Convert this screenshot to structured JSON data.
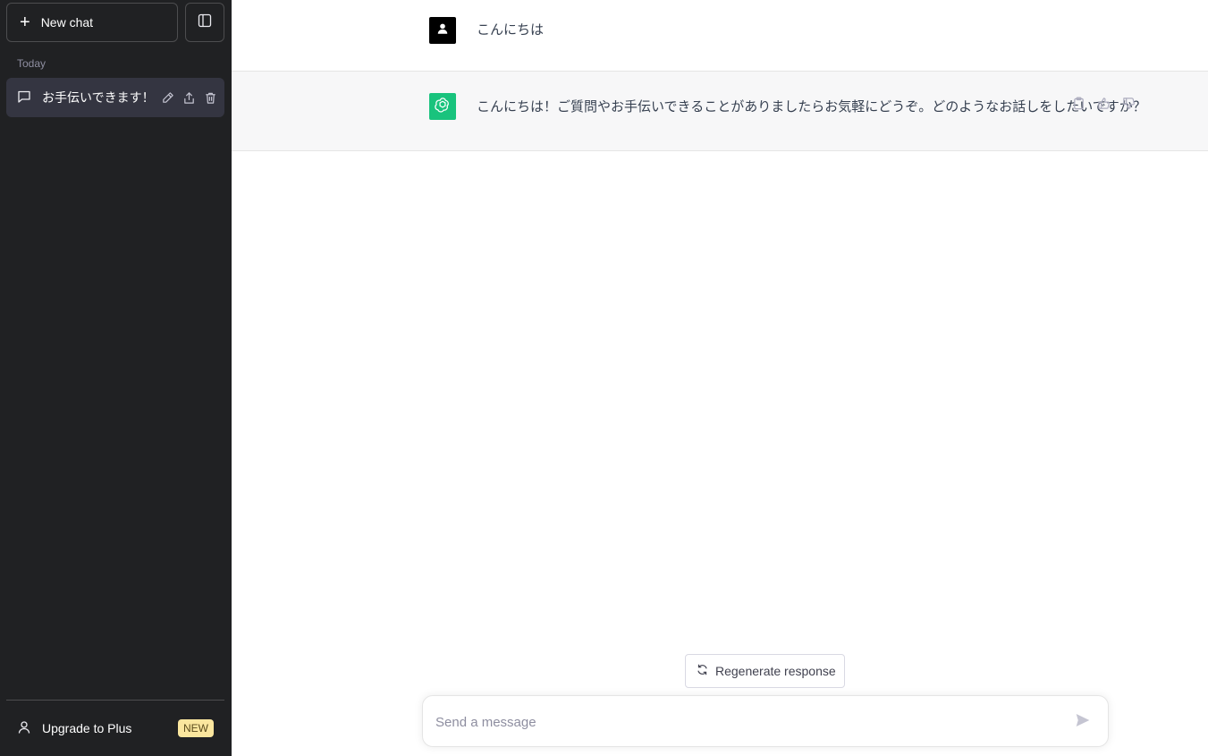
{
  "sidebar": {
    "new_chat_label": "New chat",
    "section_label": "Today",
    "items": [
      {
        "label": "お手伝いできます！"
      }
    ],
    "upgrade_label": "Upgrade to Plus",
    "upgrade_badge": "NEW"
  },
  "conversation": {
    "user_message": "こんにちは",
    "assistant_message": "こんにちは！ご質問やお手伝いできることがありましたらお気軽にどうぞ。どのようなお話しをしたいですか？"
  },
  "regenerate_label": "Regenerate response",
  "composer": {
    "placeholder": "Send a message"
  },
  "colors": {
    "sidebar_bg": "#202123",
    "selected_item_bg": "#343541",
    "assistant_avatar": "#19c37d",
    "assistant_row_bg": "#f7f7f8",
    "badge_bg": "#fae69e"
  }
}
